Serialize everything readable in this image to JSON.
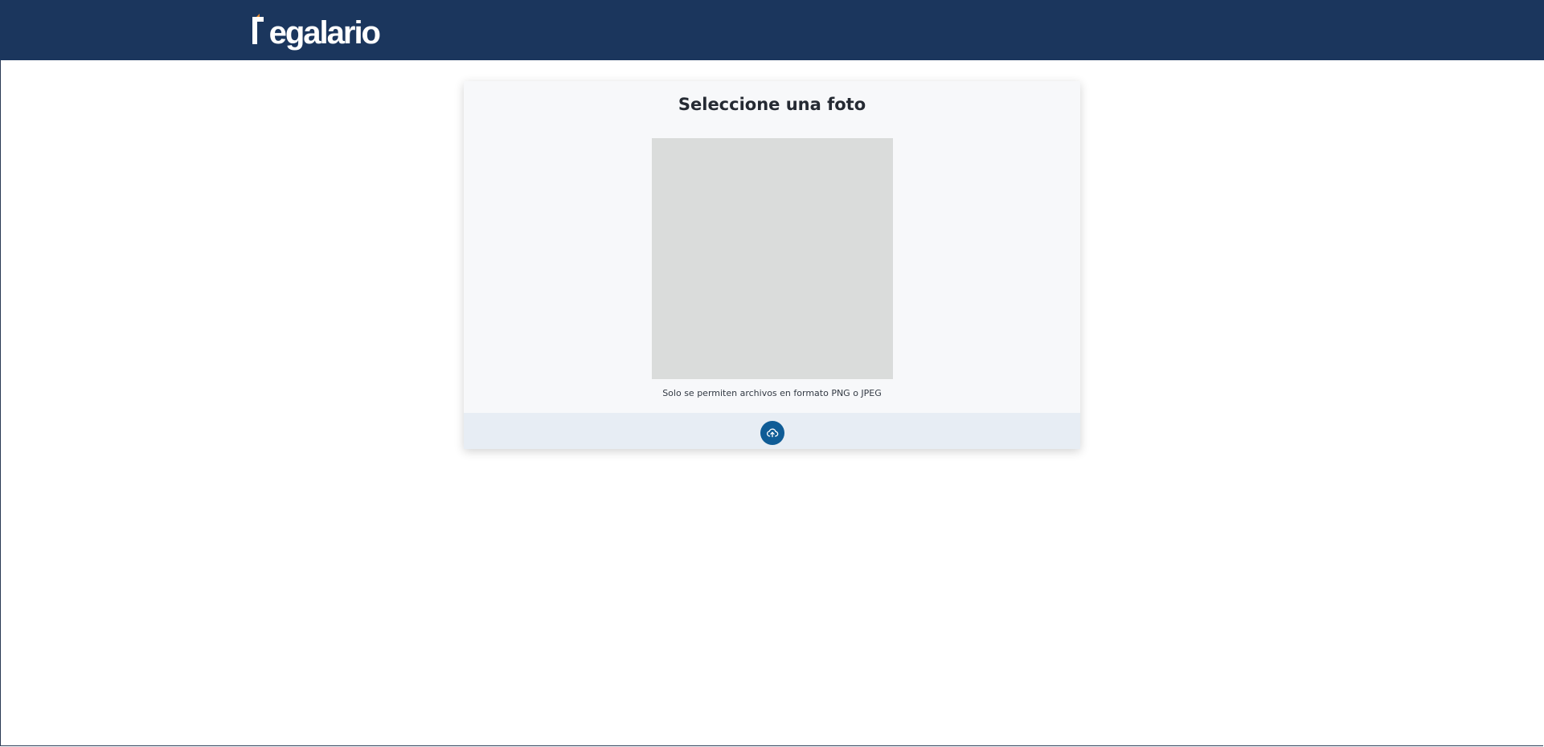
{
  "header": {
    "logo_text": "egalario",
    "logo_name": "Legalario",
    "background": "#1b365d",
    "accent": "#e8892b"
  },
  "card": {
    "title": "Seleccione una foto",
    "hint": "Solo se permiten archivos en formato PNG o JPEG",
    "upload_icon": "cloud-upload-icon",
    "button_color": "#0f5c96"
  }
}
